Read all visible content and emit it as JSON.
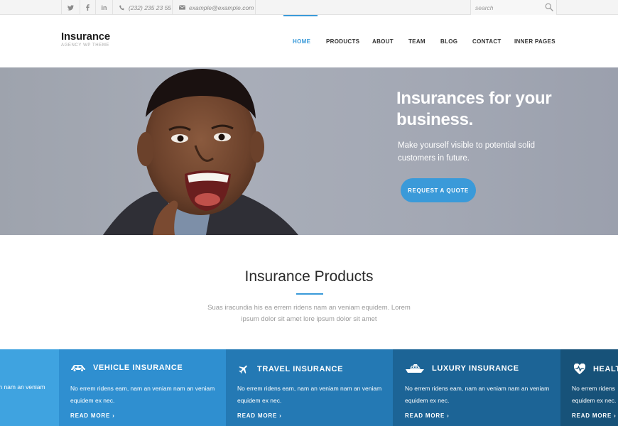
{
  "topbar": {
    "social": [
      {
        "icon": "twitter-icon"
      },
      {
        "icon": "facebook-icon"
      },
      {
        "icon": "linkedin-icon"
      }
    ],
    "phone": "(232) 235 23 55",
    "email": "example@example.com",
    "search_placeholder": "search"
  },
  "header": {
    "logo_title": "Insurance",
    "logo_subtitle": "AGENCY WP THEME",
    "nav": [
      "HOME",
      "PRODUCTS",
      "ABOUT",
      "TEAM",
      "BLOG",
      "CONTACT",
      "INNER PAGES"
    ],
    "active_nav": "HOME"
  },
  "hero": {
    "title": "Insurances for your business.",
    "subtitle": "Make yourself visible to potential solid customers in future.",
    "button": "REQUEST A QUOTE"
  },
  "products": {
    "title": "Insurance Products",
    "description": "Suas iracundia his ea errem ridens nam an veniam equidem. Lorem ipsum dolor sit amet lore ipsum dolor sit amet",
    "cards": [
      {
        "title": "",
        "icon": "",
        "text": "m nam an veniam",
        "more": "",
        "color": "#3fa3e0"
      },
      {
        "title": "VEHICLE INSURANCE",
        "icon": "car-icon",
        "text": "No errem ridens eam, nam an veniam nam an veniam equidem ex nec.",
        "more": "READ MORE",
        "color": "#2f8fd0"
      },
      {
        "title": "TRAVEL INSURANCE",
        "icon": "airplane-icon",
        "text": "No errem ridens eam, nam an veniam nam an veniam equidem ex nec.",
        "more": "READ MORE",
        "color": "#2479b4"
      },
      {
        "title": "LUXURY INSURANCE",
        "icon": "yacht-icon",
        "text": "No errem ridens eam, nam an veniam nam an veniam equidem ex nec.",
        "more": "READ MORE",
        "color": "#1c6496"
      },
      {
        "title": "HEALT",
        "icon": "heart-pulse-icon",
        "text": "No errem ridens equidem ex nec.",
        "more": "READ MORE",
        "color": "#175279"
      }
    ]
  },
  "colors": {
    "accent": "#3a9ad9",
    "heading": "#2b2b2b",
    "muted": "#9a9a9a"
  }
}
